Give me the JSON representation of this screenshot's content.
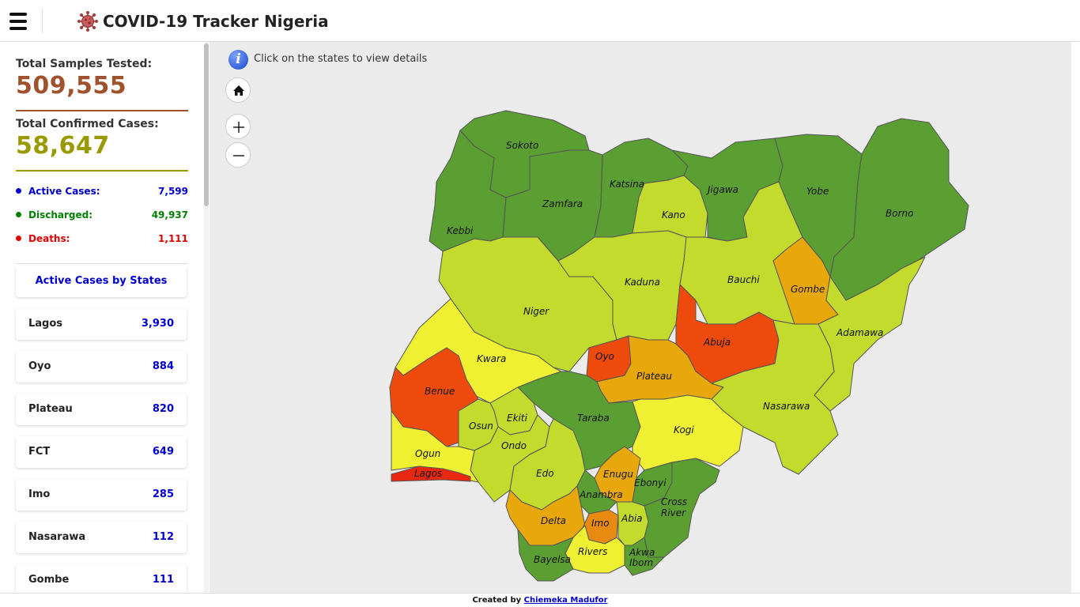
{
  "app": {
    "title": "COVID-19 Tracker Nigeria"
  },
  "stats": {
    "samples_label": "Total Samples Tested:",
    "samples_value": "509,555",
    "confirmed_label": "Total Confirmed Cases:",
    "confirmed_value": "58,647",
    "active_label": "Active Cases:",
    "active_value": "7,599",
    "discharged_label": "Discharged:",
    "discharged_value": "49,937",
    "deaths_label": "Deaths:",
    "deaths_value": "1,111"
  },
  "active_by_state": {
    "heading": "Active Cases by States",
    "rows": [
      {
        "name": "Lagos",
        "value": "3,930"
      },
      {
        "name": "Oyo",
        "value": "884"
      },
      {
        "name": "Plateau",
        "value": "820"
      },
      {
        "name": "FCT",
        "value": "649"
      },
      {
        "name": "Imo",
        "value": "285"
      },
      {
        "name": "Nasarawa",
        "value": "112"
      },
      {
        "name": "Gombe",
        "value": "111"
      }
    ]
  },
  "map": {
    "info_text": "Click on the states to view details",
    "colors": {
      "dark_green": "#5b9e32",
      "yellow_green": "#c2db2c",
      "yellow": "#f0f032",
      "orange_yellow": "#e8a80c",
      "orange": "#e88a10",
      "red_orange": "#ee4a0c",
      "red": "#e82810"
    },
    "states": [
      {
        "id": "sokoto",
        "name": "Sokoto",
        "color": "#5b9e32"
      },
      {
        "id": "kebbi",
        "name": "Kebbi",
        "color": "#5b9e32"
      },
      {
        "id": "zamfara",
        "name": "Zamfara",
        "color": "#5b9e32"
      },
      {
        "id": "katsina",
        "name": "Katsina",
        "color": "#5b9e32"
      },
      {
        "id": "kano",
        "name": "Kano",
        "color": "#c2db2c"
      },
      {
        "id": "jigawa",
        "name": "Jigawa",
        "color": "#5b9e32"
      },
      {
        "id": "yobe",
        "name": "Yobe",
        "color": "#5b9e32"
      },
      {
        "id": "borno",
        "name": "Borno",
        "color": "#5b9e32"
      },
      {
        "id": "niger",
        "name": "Niger",
        "color": "#c2db2c"
      },
      {
        "id": "kaduna",
        "name": "Kaduna",
        "color": "#c2db2c"
      },
      {
        "id": "bauchi",
        "name": "Bauchi",
        "color": "#c2db2c"
      },
      {
        "id": "gombe",
        "name": "Gombe",
        "color": "#e8a80c"
      },
      {
        "id": "adamawa",
        "name": "Adamawa",
        "color": "#c2db2c"
      },
      {
        "id": "kwara",
        "name": "Kwara",
        "color": "#f0f032"
      },
      {
        "id": "oyo",
        "name": "Oyo",
        "color": "#ee4a0c"
      },
      {
        "id": "abuja",
        "name": "Abuja",
        "color": "#ee4a0c"
      },
      {
        "id": "plateau",
        "name": "Plateau",
        "color": "#ee4a0c"
      },
      {
        "id": "nasarawa",
        "name": "Nasarawa",
        "color": "#e8a80c"
      },
      {
        "id": "taraba",
        "name": "Taraba",
        "color": "#c2db2c"
      },
      {
        "id": "kogi",
        "name": "Kogi",
        "color": "#5b9e32"
      },
      {
        "id": "benue",
        "name": "Benue",
        "color": "#f0f032"
      },
      {
        "id": "ekiti",
        "name": "Ekiti",
        "color": "#c2db2c"
      },
      {
        "id": "osun",
        "name": "Osun",
        "color": "#c2db2c"
      },
      {
        "id": "ondo",
        "name": "Ondo",
        "color": "#c2db2c"
      },
      {
        "id": "ogun",
        "name": "Ogun",
        "color": "#f0f032"
      },
      {
        "id": "lagos",
        "name": "Lagos",
        "color": "#e82810"
      },
      {
        "id": "edo",
        "name": "Edo",
        "color": "#c2db2c"
      },
      {
        "id": "enugu",
        "name": "Enugu",
        "color": "#e8a80c"
      },
      {
        "id": "ebonyi",
        "name": "Ebonyi",
        "color": "#5b9e32"
      },
      {
        "id": "cross_river",
        "name": "Cross River",
        "color": "#5b9e32"
      },
      {
        "id": "anambra",
        "name": "Anambra",
        "color": "#5b9e32"
      },
      {
        "id": "delta",
        "name": "Delta",
        "color": "#e8a80c"
      },
      {
        "id": "imo",
        "name": "Imo",
        "color": "#e88a10"
      },
      {
        "id": "abia",
        "name": "Abia",
        "color": "#c2db2c"
      },
      {
        "id": "rivers",
        "name": "Rivers",
        "color": "#f0f032"
      },
      {
        "id": "akwa_ibom",
        "name": "Akwa Ibom",
        "color": "#5b9e32"
      },
      {
        "id": "bayelsa",
        "name": "Bayelsa",
        "color": "#5b9e32"
      }
    ]
  },
  "footer": {
    "prefix": "Created by",
    "author": "Chiemeka Madufor"
  }
}
